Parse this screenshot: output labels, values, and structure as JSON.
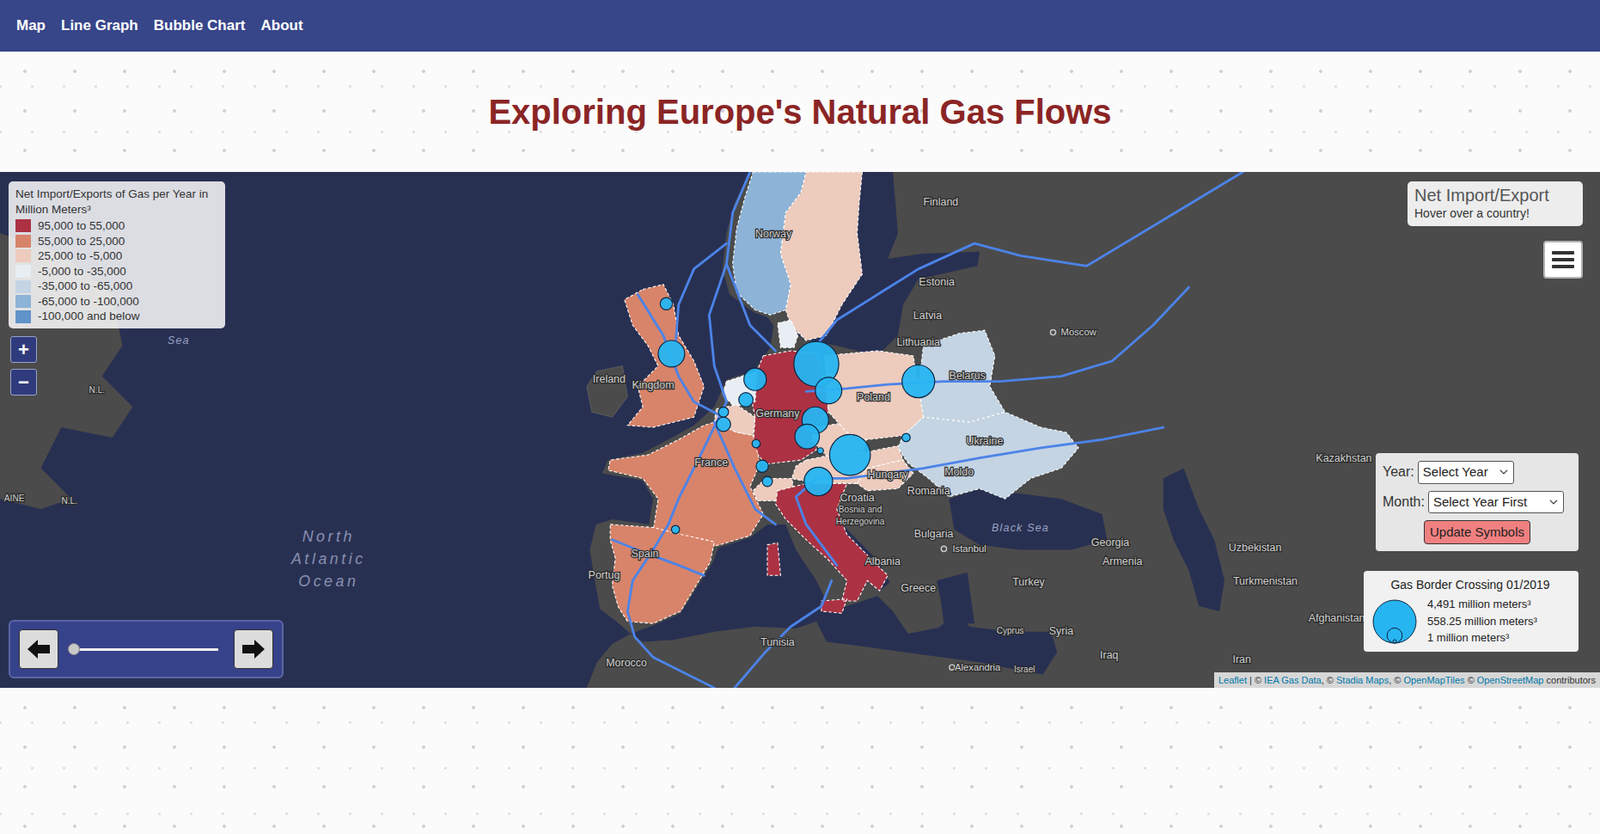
{
  "nav": {
    "items": [
      "Map",
      "Line Graph",
      "Bubble Chart",
      "About"
    ]
  },
  "title": "Exploring Europe's Natural Gas Flows",
  "legend": {
    "title": "Net Import/Exports of Gas per Year in Million Meters³",
    "items": [
      {
        "label": "95,000 to 55,000",
        "color": "#ac3243"
      },
      {
        "label": "55,000 to 25,000",
        "color": "#d8846a"
      },
      {
        "label": "25,000 to -5,000",
        "color": "#edcbbd"
      },
      {
        "label": "-5,000 to -35,000",
        "color": "#e8eef3"
      },
      {
        "label": "-35,000 to -65,000",
        "color": "#c4d4e3"
      },
      {
        "label": "-65,000 to -100,000",
        "color": "#8db3d7"
      },
      {
        "label": "-100,000 and below",
        "color": "#5f93c9"
      }
    ]
  },
  "zoom": {
    "in": "+",
    "out": "−"
  },
  "info": {
    "title": "Net Import/Export",
    "hint": "Hover over a country!"
  },
  "controls": {
    "year_label": "Year:",
    "year_value": "Select Year",
    "month_label": "Month:",
    "month_value": "Select Year First",
    "button": "Update Symbols"
  },
  "symbol_legend": {
    "title": "Gas Border Crossing 01/2019",
    "items": [
      {
        "label": "4,491 million meters³",
        "value": 4491
      },
      {
        "label": "558.25 million meters³",
        "value": 558.25
      },
      {
        "label": "1 million meters³",
        "value": 1
      }
    ]
  },
  "time_slider": {
    "level": 0
  },
  "attribution": [
    {
      "text": "Leaflet",
      "link": true
    },
    {
      "text": " | © ",
      "link": false
    },
    {
      "text": "IEA Gas Data",
      "link": true
    },
    {
      "text": ", © ",
      "link": false
    },
    {
      "text": "Stadia Maps",
      "link": true
    },
    {
      "text": ", © ",
      "link": false
    },
    {
      "text": "OpenMapTiles",
      "link": true
    },
    {
      "text": " © ",
      "link": false
    },
    {
      "text": "OpenStreetMap",
      "link": true
    },
    {
      "text": " contributors",
      "link": false
    }
  ],
  "map": {
    "countries": [
      {
        "color": "#8db3d7"
      },
      {
        "color": "#edcbbd"
      },
      {
        "color": "#e8eef3"
      },
      {
        "color": "#ac3243"
      },
      {
        "color": "#e8eef3"
      },
      {
        "color": "#edcbbd"
      },
      {
        "color": "#d8846a"
      },
      {
        "color": "#edcbbd"
      },
      {
        "color": "#edcbbd"
      },
      {
        "color": "#edcbbd"
      },
      {
        "color": "#ac3243"
      },
      {
        "color": "#edcbbd"
      },
      {
        "color": "#edcbbd"
      },
      {
        "color": "#edcbbd"
      },
      {
        "color": "#c4d4e3"
      },
      {
        "color": "#c4d4e3"
      },
      {
        "color": "#d8846a"
      },
      {
        "color": "#d8846a"
      }
    ],
    "bubbles": [
      {
        "value": 4491
      },
      {
        "value": 1570
      },
      {
        "value": 2380
      },
      {
        "value": 1570
      },
      {
        "value": 1120
      },
      {
        "value": 335
      },
      {
        "value": 455
      },
      {
        "value": 230
      },
      {
        "value": 455
      },
      {
        "value": 1570
      },
      {
        "value": 1340
      },
      {
        "value": 3710
      },
      {
        "value": 1820
      },
      {
        "value": 335
      },
      {
        "value": 150
      },
      {
        "value": 84
      },
      {
        "value": 230
      },
      {
        "value": 150
      },
      {
        "value": 150
      }
    ],
    "labels": [
      {
        "text": "Finland",
        "kind": "country"
      },
      {
        "text": "Estonia",
        "kind": "country"
      },
      {
        "text": "Latvia",
        "kind": "country"
      },
      {
        "text": "Lithuania",
        "kind": "country"
      },
      {
        "text": "Moscow",
        "kind": "city"
      },
      {
        "text": "Belarus",
        "kind": "country"
      },
      {
        "text": "Poland",
        "kind": "country"
      },
      {
        "text": "Ukraine",
        "kind": "country"
      },
      {
        "text": "Germany",
        "kind": "country"
      },
      {
        "text": "France",
        "kind": "country"
      },
      {
        "text": "Spain",
        "kind": "country"
      },
      {
        "text": "Portug",
        "kind": "country"
      },
      {
        "text": "Ireland",
        "kind": "country"
      },
      {
        "text": "Kingdom",
        "kind": "country"
      },
      {
        "text": "Norway",
        "kind": "country"
      },
      {
        "text": "Romania",
        "kind": "country"
      },
      {
        "text": "Hungary",
        "kind": "country"
      },
      {
        "text": "Croatia",
        "kind": "country"
      },
      {
        "text": "Moldo",
        "kind": "country"
      },
      {
        "text": "Bosnia and",
        "kind": "small"
      },
      {
        "text": "Herzegovina",
        "kind": "small"
      },
      {
        "text": "Bulgaria",
        "kind": "country"
      },
      {
        "text": "Istanbul",
        "kind": "city"
      },
      {
        "text": "Black Sea",
        "kind": "water"
      },
      {
        "text": "Georgia",
        "kind": "country"
      },
      {
        "text": "Armenia",
        "kind": "country"
      },
      {
        "text": "Albania",
        "kind": "country"
      },
      {
        "text": "Greece",
        "kind": "country"
      },
      {
        "text": "Turkey",
        "kind": "country"
      },
      {
        "text": "Cyprus",
        "kind": "small"
      },
      {
        "text": "Syria",
        "kind": "country"
      },
      {
        "text": "Iraq",
        "kind": "country"
      },
      {
        "text": "Iran",
        "kind": "country"
      },
      {
        "text": "Tunisia",
        "kind": "country"
      },
      {
        "text": "Morocco",
        "kind": "country"
      },
      {
        "text": "Alexandria",
        "kind": "city"
      },
      {
        "text": "Israel",
        "kind": "small"
      },
      {
        "text": "Kazakhstan",
        "kind": "country"
      },
      {
        "text": "Uzbekistan",
        "kind": "country"
      },
      {
        "text": "Turkmenistan",
        "kind": "country"
      },
      {
        "text": "Afghanistan",
        "kind": "country"
      },
      {
        "text": "North",
        "kind": "ocean"
      },
      {
        "text": "Atlantic",
        "kind": "ocean"
      },
      {
        "text": "Ocean",
        "kind": "ocean"
      },
      {
        "text": "N.L.",
        "kind": "small"
      },
      {
        "text": "N.L.",
        "kind": "small"
      },
      {
        "text": "AINE",
        "kind": "small"
      },
      {
        "text": "Sea",
        "kind": "water"
      }
    ]
  }
}
